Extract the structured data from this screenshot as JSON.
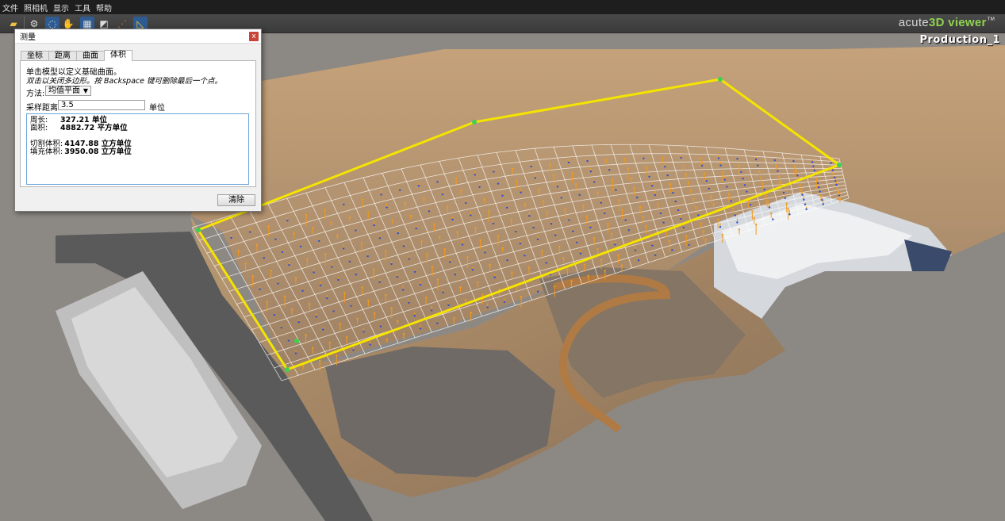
{
  "menu": [
    "文件",
    "照相机",
    "显示",
    "工具",
    "帮助"
  ],
  "toolbar": {
    "icons": [
      "open-folder-icon",
      "settings-icon",
      "orbit-icon",
      "pan-hand-icon",
      "checker-icon",
      "grid-icon",
      "measure-icon"
    ]
  },
  "brand": {
    "prefix": "acute",
    "accent": "3D viewer",
    "tm": "™"
  },
  "viewport": {
    "title": "Production_1"
  },
  "dialog": {
    "title": "测量",
    "close": "x",
    "tabs": [
      "坐标",
      "距离",
      "曲面",
      "体积"
    ],
    "active_tab": 3,
    "hint1": "单击模型以定义基础曲面。",
    "hint2": "双击以关闭多边形。按 Backspace 键可删除最后一个点。",
    "method_label": "方法:",
    "method_value": "均值平面",
    "sampling_label": "采样距离:",
    "sampling_value": "3.5",
    "sampling_unit": "单位",
    "results": {
      "perimeter_label": "周长:",
      "perimeter_value": "327.21 单位",
      "area_label": "面积:",
      "area_value": "4882.72 平方单位",
      "cut_label": "切割体积:",
      "cut_value": "4147.88 立方单位",
      "fill_label": "填充体积:",
      "fill_value": "3950.08 立方单位"
    },
    "clear_label": "清除"
  },
  "colors": {
    "polygon": "#f5e400",
    "vertex": "#39d353",
    "grid": "#ffffff",
    "cut_pin": "#f39a1c",
    "fill_pin": "#2a4fd6",
    "brand_accent": "#8fd24e"
  }
}
